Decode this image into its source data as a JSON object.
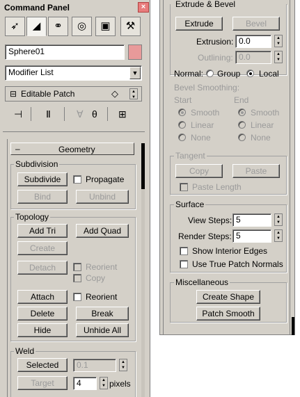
{
  "left": {
    "title": "Command Panel",
    "object_name": "Sphere01",
    "object_color": "#e89a9a",
    "modifier_list": "Modifier List",
    "stack_item": "Editable Patch",
    "rollout_title": "Geometry",
    "subdivision": {
      "label": "Subdivision",
      "subdivide": "Subdivide",
      "propagate": "Propagate",
      "bind": "Bind",
      "unbind": "Unbind"
    },
    "topology": {
      "label": "Topology",
      "add_tri": "Add Tri",
      "add_quad": "Add Quad",
      "create": "Create",
      "detach": "Detach",
      "reorient": "Reorient",
      "copy": "Copy",
      "attach": "Attach",
      "attach_reorient": "Reorient",
      "delete": "Delete",
      "break": "Break",
      "hide": "Hide",
      "unhide_all": "Unhide All"
    },
    "weld": {
      "label": "Weld",
      "selected": "Selected",
      "selected_value": "0.1",
      "target": "Target",
      "target_value": "4",
      "pixels": "pixels"
    }
  },
  "right": {
    "extrude_bevel": {
      "label": "Extrude & Bevel",
      "extrude": "Extrude",
      "bevel": "Bevel",
      "extrusion_label": "Extrusion:",
      "extrusion_value": "0.0",
      "outlining_label": "Outlining:",
      "outlining_value": "0.0",
      "normal_label": "Normal:",
      "group": "Group",
      "local": "Local",
      "bevel_smoothing": "Bevel Smoothing:",
      "start": "Start",
      "end": "End",
      "smooth": "Smooth",
      "linear": "Linear",
      "none": "None"
    },
    "tangent": {
      "label": "Tangent",
      "copy": "Copy",
      "paste": "Paste",
      "paste_length": "Paste Length"
    },
    "surface": {
      "label": "Surface",
      "view_steps_label": "View Steps:",
      "view_steps": "5",
      "render_steps_label": "Render Steps:",
      "render_steps": "5",
      "show_interior_edges": "Show Interior Edges",
      "use_true_patch_normals": "Use True Patch Normals"
    },
    "misc": {
      "label": "Miscellaneous",
      "create_shape": "Create Shape",
      "patch_smooth": "Patch Smooth"
    }
  }
}
